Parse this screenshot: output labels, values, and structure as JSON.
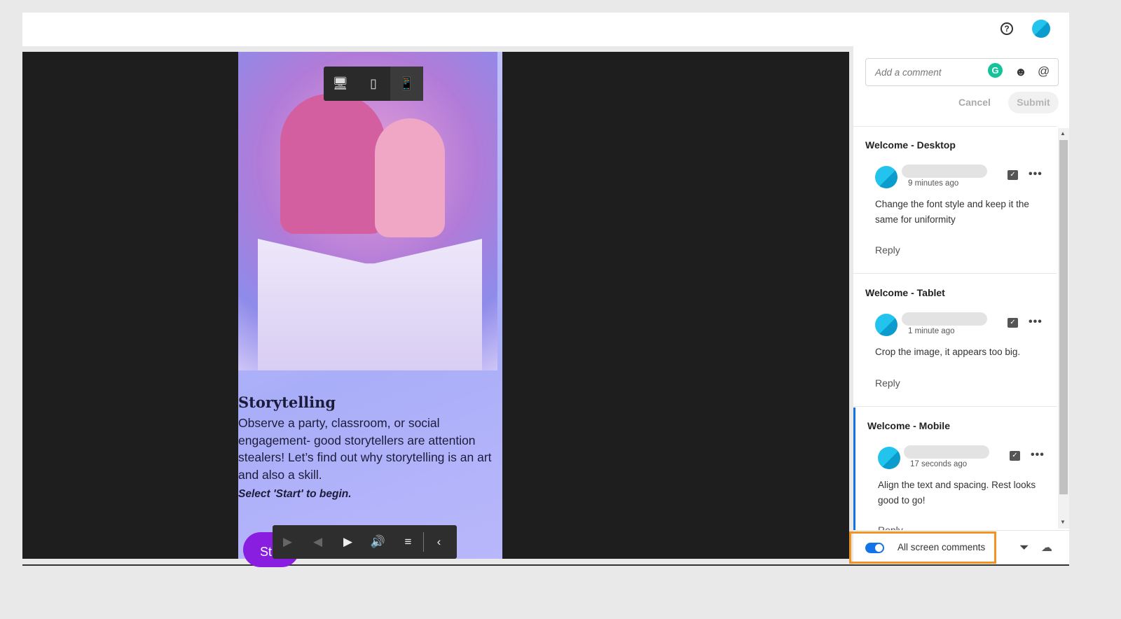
{
  "header": {
    "help_icon": "?",
    "avatar": "user-avatar"
  },
  "device_toolbar": {
    "items": [
      {
        "name": "desktop",
        "icon": "🖥"
      },
      {
        "name": "tablet",
        "icon": "▯"
      },
      {
        "name": "mobile",
        "icon": "📱"
      }
    ],
    "selected": "mobile"
  },
  "slide": {
    "title": "Storytelling",
    "body": "Observe a party, classroom, or social engagement- good storytellers are attention stealers! Let’s find out why storytelling is an art and also a skill.",
    "cta": "Select 'Start' to begin.",
    "start_button": "St"
  },
  "player": {
    "play": "▶",
    "prev": "◀",
    "next": "▶",
    "volume": "🔊",
    "menu": "≡",
    "collapse": "‹"
  },
  "comments": {
    "placeholder": "Add a comment",
    "grammarly": "G",
    "emoji": "☻",
    "mention": "@",
    "cancel": "Cancel",
    "submit": "Submit",
    "threads": [
      {
        "title": "Welcome - Desktop",
        "time": "9 minutes ago",
        "text": "Change the font style and keep it the same for uniformity",
        "reply": "Reply"
      },
      {
        "title": "Welcome - Tablet",
        "time": "1 minute ago",
        "text": "Crop the image, it appears too big.",
        "reply": "Reply"
      },
      {
        "title": "Welcome - Mobile",
        "time": "17 seconds ago",
        "text": "Align the text and spacing. Rest looks good to go!",
        "reply": "Reply"
      }
    ],
    "toggle_label": "All screen comments",
    "toggle_on": true,
    "accent": "#1473e6",
    "highlight": "#f29423"
  }
}
